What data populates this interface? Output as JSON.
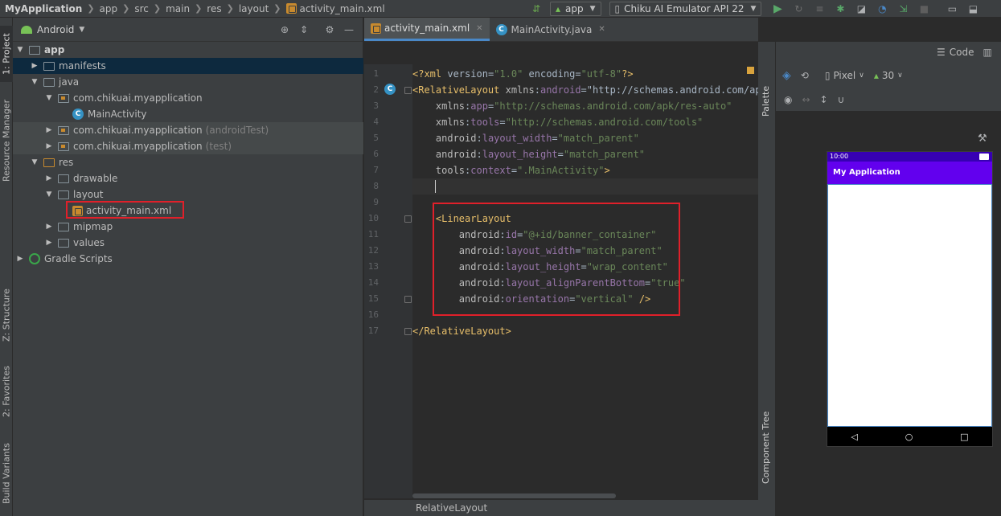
{
  "breadcrumbs": [
    "MyApplication",
    "app",
    "src",
    "main",
    "res",
    "layout",
    "activity_main.xml"
  ],
  "toolbar": {
    "run_config": "app",
    "device": "Chiku AI Emulator API 22"
  },
  "left_tool_tabs": [
    "1: Project",
    "Resource Manager",
    "Z: Structure",
    "2: Favorites",
    "Build Variants"
  ],
  "project": {
    "view_mode": "Android",
    "tree": [
      {
        "label": "app",
        "suffix": "",
        "depth": 0,
        "expanded": true,
        "icon": "module-icon",
        "bold": true
      },
      {
        "label": "manifests",
        "suffix": "",
        "depth": 1,
        "expanded": false,
        "icon": "folder-icon"
      },
      {
        "label": "java",
        "suffix": "",
        "depth": 1,
        "expanded": true,
        "icon": "folder-icon"
      },
      {
        "label": "com.chikuai.myapplication",
        "suffix": "",
        "depth": 2,
        "expanded": true,
        "icon": "package-icon"
      },
      {
        "label": "MainActivity",
        "suffix": "",
        "depth": 3,
        "expanded": null,
        "icon": "class-icon"
      },
      {
        "label": "com.chikuai.myapplication",
        "suffix": "(androidTest)",
        "depth": 2,
        "expanded": false,
        "icon": "package-icon"
      },
      {
        "label": "com.chikuai.myapplication",
        "suffix": "(test)",
        "depth": 2,
        "expanded": false,
        "icon": "package-icon"
      },
      {
        "label": "res",
        "suffix": "",
        "depth": 1,
        "expanded": true,
        "icon": "res-folder-icon"
      },
      {
        "label": "drawable",
        "suffix": "",
        "depth": 2,
        "expanded": false,
        "icon": "folder-icon"
      },
      {
        "label": "layout",
        "suffix": "",
        "depth": 2,
        "expanded": true,
        "icon": "folder-icon"
      },
      {
        "label": "activity_main.xml",
        "suffix": "",
        "depth": 3,
        "expanded": null,
        "icon": "xml-file-icon"
      },
      {
        "label": "mipmap",
        "suffix": "",
        "depth": 2,
        "expanded": false,
        "icon": "folder-icon"
      },
      {
        "label": "values",
        "suffix": "",
        "depth": 2,
        "expanded": false,
        "icon": "folder-icon"
      },
      {
        "label": "Gradle Scripts",
        "suffix": "",
        "depth": 0,
        "expanded": false,
        "icon": "gradle-icon"
      }
    ]
  },
  "editor": {
    "tabs": [
      {
        "label": "activity_main.xml",
        "active": true
      },
      {
        "label": "MainActivity.java",
        "active": false
      }
    ],
    "lines": [
      "<?xml version=\"1.0\" encoding=\"utf-8\"?>",
      "<RelativeLayout xmlns:android=\"http://schemas.android.com/apk",
      "    xmlns:app=\"http://schemas.android.com/apk/res-auto\"",
      "    xmlns:tools=\"http://schemas.android.com/tools\"",
      "    android:layout_width=\"match_parent\"",
      "    android:layout_height=\"match_parent\"",
      "    tools:context=\".MainActivity\">",
      "    ",
      "",
      "    <LinearLayout",
      "        android:id=\"@+id/banner_container\"",
      "        android:layout_width=\"match_parent\"",
      "        android:layout_height=\"wrap_content\"",
      "        android:layout_alignParentBottom=\"true\"",
      "        android:orientation=\"vertical\" />",
      "",
      "</RelativeLayout>"
    ],
    "status_breadcrumb": "RelativeLayout"
  },
  "design": {
    "view_mode_label": "Code",
    "palette_tab": "Palette",
    "component_tree_tab": "Component Tree",
    "device_label": "Pixel",
    "api_label": "30",
    "preview": {
      "time": "10:00",
      "app_title": "My Application"
    }
  },
  "colors": {
    "accent_purple": "#6200ee",
    "status_purple": "#3700b3",
    "highlight_red": "#e0202a",
    "selection_blue": "#0d293e"
  }
}
